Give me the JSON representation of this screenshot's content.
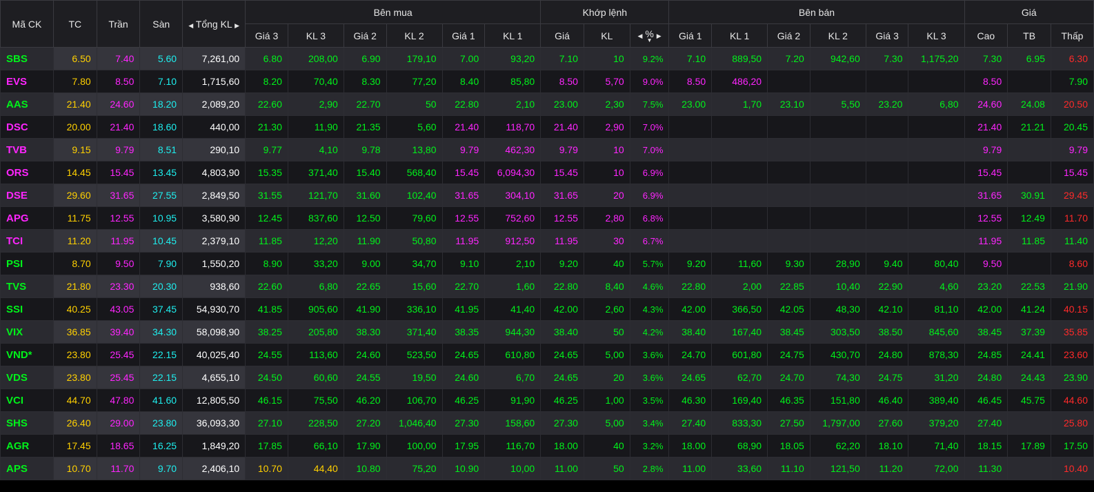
{
  "header": {
    "symbol": "Mã CK",
    "ref": "TC",
    "ceil": "Trần",
    "floor": "Sàn",
    "total_vol": "Tổng KL",
    "buy_group": "Bên mua",
    "match_group": "Khớp lệnh",
    "sell_group": "Bên bán",
    "price_group": "Giá",
    "bid3": "Giá 3",
    "bvol3": "KL 3",
    "bid2": "Giá 2",
    "bvol2": "KL 2",
    "bid1": "Giá 1",
    "bvol1": "KL 1",
    "mprice": "Giá",
    "mvol": "KL",
    "mpct": "%",
    "ask1": "Giá 1",
    "avol1": "KL 1",
    "ask2": "Giá 2",
    "avol2": "KL 2",
    "ask3": "Giá 3",
    "avol3": "KL 3",
    "high": "Cao",
    "avg": "TB",
    "low": "Thấp"
  },
  "colors": {
    "up": "#00f21a",
    "ceiling": "#ff25ff",
    "floor": "#1eeeee",
    "reference": "#ffd000",
    "down": "#ff2a2a"
  },
  "rows": [
    {
      "s": "SBS",
      "c": [
        "6.50",
        "7.40",
        "5.60",
        "7,261,00",
        "6.80",
        "208,00",
        "6.90",
        "179,10",
        "7.00",
        "93,20",
        "7.10",
        "10",
        "9.2%",
        "7.10",
        "889,50",
        "7.20",
        "942,60",
        "7.30",
        "1,175,20",
        "7.30",
        "6.95",
        "6.30"
      ],
      "k": [
        "u",
        "r",
        "c",
        "f",
        "w",
        "u",
        "u",
        "u",
        "u",
        "u",
        "u",
        "u",
        "u",
        "u",
        "u",
        "u",
        "u",
        "u",
        "u",
        "u",
        "u",
        "u",
        "d"
      ]
    },
    {
      "s": "EVS",
      "c": [
        "7.80",
        "8.50",
        "7.10",
        "1,715,60",
        "8.20",
        "70,40",
        "8.30",
        "77,20",
        "8.40",
        "85,80",
        "8.50",
        "5,70",
        "9.0%",
        "8.50",
        "486,20",
        "",
        "",
        "",
        "",
        "8.50",
        "",
        "7.90"
      ],
      "k": [
        "c",
        "r",
        "c",
        "f",
        "w",
        "u",
        "u",
        "u",
        "u",
        "u",
        "u",
        "c",
        "c",
        "c",
        "c",
        "c",
        "",
        "",
        "",
        "",
        "c",
        "",
        "u"
      ]
    },
    {
      "s": "AAS",
      "c": [
        "21.40",
        "24.60",
        "18.20",
        "2,089,20",
        "22.60",
        "2,90",
        "22.70",
        "50",
        "22.80",
        "2,10",
        "23.00",
        "2,30",
        "7.5%",
        "23.00",
        "1,70",
        "23.10",
        "5,50",
        "23.20",
        "6,80",
        "24.60",
        "24.08",
        "20.50"
      ],
      "k": [
        "u",
        "r",
        "c",
        "f",
        "w",
        "u",
        "u",
        "u",
        "u",
        "u",
        "u",
        "u",
        "u",
        "u",
        "u",
        "u",
        "u",
        "u",
        "u",
        "u",
        "c",
        "u",
        "d"
      ]
    },
    {
      "s": "DSC",
      "c": [
        "20.00",
        "21.40",
        "18.60",
        "440,00",
        "21.30",
        "11,90",
        "21.35",
        "5,60",
        "21.40",
        "118,70",
        "21.40",
        "2,90",
        "7.0%",
        "",
        "",
        "",
        "",
        "",
        "",
        "21.40",
        "21.21",
        "20.45"
      ],
      "k": [
        "c",
        "r",
        "c",
        "f",
        "w",
        "u",
        "u",
        "u",
        "u",
        "c",
        "c",
        "c",
        "c",
        "c",
        "",
        "",
        "",
        "",
        "",
        "",
        "c",
        "u",
        "u"
      ]
    },
    {
      "s": "TVB",
      "c": [
        "9.15",
        "9.79",
        "8.51",
        "290,10",
        "9.77",
        "4,10",
        "9.78",
        "13,80",
        "9.79",
        "462,30",
        "9.79",
        "10",
        "7.0%",
        "",
        "",
        "",
        "",
        "",
        "",
        "9.79",
        "",
        "9.79"
      ],
      "k": [
        "c",
        "r",
        "c",
        "f",
        "w",
        "u",
        "u",
        "u",
        "u",
        "c",
        "c",
        "c",
        "c",
        "c",
        "",
        "",
        "",
        "",
        "",
        "",
        "c",
        "",
        "c"
      ]
    },
    {
      "s": "ORS",
      "c": [
        "14.45",
        "15.45",
        "13.45",
        "4,803,90",
        "15.35",
        "371,40",
        "15.40",
        "568,40",
        "15.45",
        "6,094,30",
        "15.45",
        "10",
        "6.9%",
        "",
        "",
        "",
        "",
        "",
        "",
        "15.45",
        "",
        "15.45"
      ],
      "k": [
        "c",
        "r",
        "c",
        "f",
        "w",
        "u",
        "u",
        "u",
        "u",
        "c",
        "c",
        "c",
        "c",
        "c",
        "",
        "",
        "",
        "",
        "",
        "",
        "c",
        "",
        "c"
      ]
    },
    {
      "s": "DSE",
      "c": [
        "29.60",
        "31.65",
        "27.55",
        "2,849,50",
        "31.55",
        "121,70",
        "31.60",
        "102,40",
        "31.65",
        "304,10",
        "31.65",
        "20",
        "6.9%",
        "",
        "",
        "",
        "",
        "",
        "",
        "31.65",
        "30.91",
        "29.45"
      ],
      "k": [
        "c",
        "r",
        "c",
        "f",
        "w",
        "u",
        "u",
        "u",
        "u",
        "c",
        "c",
        "c",
        "c",
        "c",
        "",
        "",
        "",
        "",
        "",
        "",
        "c",
        "u",
        "d"
      ]
    },
    {
      "s": "APG",
      "c": [
        "11.75",
        "12.55",
        "10.95",
        "3,580,90",
        "12.45",
        "837,60",
        "12.50",
        "79,60",
        "12.55",
        "752,60",
        "12.55",
        "2,80",
        "6.8%",
        "",
        "",
        "",
        "",
        "",
        "",
        "12.55",
        "12.49",
        "11.70"
      ],
      "k": [
        "c",
        "r",
        "c",
        "f",
        "w",
        "u",
        "u",
        "u",
        "u",
        "c",
        "c",
        "c",
        "c",
        "c",
        "",
        "",
        "",
        "",
        "",
        "",
        "c",
        "u",
        "d"
      ]
    },
    {
      "s": "TCI",
      "c": [
        "11.20",
        "11.95",
        "10.45",
        "2,379,10",
        "11.85",
        "12,20",
        "11.90",
        "50,80",
        "11.95",
        "912,50",
        "11.95",
        "30",
        "6.7%",
        "",
        "",
        "",
        "",
        "",
        "",
        "11.95",
        "11.85",
        "11.40"
      ],
      "k": [
        "c",
        "r",
        "c",
        "f",
        "w",
        "u",
        "u",
        "u",
        "u",
        "c",
        "c",
        "c",
        "c",
        "c",
        "",
        "",
        "",
        "",
        "",
        "",
        "c",
        "u",
        "u"
      ]
    },
    {
      "s": "PSI",
      "c": [
        "8.70",
        "9.50",
        "7.90",
        "1,550,20",
        "8.90",
        "33,20",
        "9.00",
        "34,70",
        "9.10",
        "2,10",
        "9.20",
        "40",
        "5.7%",
        "9.20",
        "11,60",
        "9.30",
        "28,90",
        "9.40",
        "80,40",
        "9.50",
        "",
        "8.60"
      ],
      "k": [
        "u",
        "r",
        "c",
        "f",
        "w",
        "u",
        "u",
        "u",
        "u",
        "u",
        "u",
        "u",
        "u",
        "u",
        "u",
        "u",
        "u",
        "u",
        "u",
        "u",
        "c",
        "",
        "d"
      ]
    },
    {
      "s": "TVS",
      "c": [
        "21.80",
        "23.30",
        "20.30",
        "938,60",
        "22.60",
        "6,80",
        "22.65",
        "15,60",
        "22.70",
        "1,60",
        "22.80",
        "8,40",
        "4.6%",
        "22.80",
        "2,00",
        "22.85",
        "10,40",
        "22.90",
        "4,60",
        "23.20",
        "22.53",
        "21.90"
      ],
      "k": [
        "u",
        "r",
        "c",
        "f",
        "w",
        "u",
        "u",
        "u",
        "u",
        "u",
        "u",
        "u",
        "u",
        "u",
        "u",
        "u",
        "u",
        "u",
        "u",
        "u",
        "u",
        "u",
        "u"
      ]
    },
    {
      "s": "SSI",
      "c": [
        "40.25",
        "43.05",
        "37.45",
        "54,930,70",
        "41.85",
        "905,60",
        "41.90",
        "336,10",
        "41.95",
        "41,40",
        "42.00",
        "2,60",
        "4.3%",
        "42.00",
        "366,50",
        "42.05",
        "48,30",
        "42.10",
        "81,10",
        "42.00",
        "41.24",
        "40.15"
      ],
      "k": [
        "u",
        "r",
        "c",
        "f",
        "w",
        "u",
        "u",
        "u",
        "u",
        "u",
        "u",
        "u",
        "u",
        "u",
        "u",
        "u",
        "u",
        "u",
        "u",
        "u",
        "u",
        "u",
        "d"
      ]
    },
    {
      "s": "VIX",
      "c": [
        "36.85",
        "39.40",
        "34.30",
        "58,098,90",
        "38.25",
        "205,80",
        "38.30",
        "371,40",
        "38.35",
        "944,30",
        "38.40",
        "50",
        "4.2%",
        "38.40",
        "167,40",
        "38.45",
        "303,50",
        "38.50",
        "845,60",
        "38.45",
        "37.39",
        "35.85"
      ],
      "k": [
        "u",
        "r",
        "c",
        "f",
        "w",
        "u",
        "u",
        "u",
        "u",
        "u",
        "u",
        "u",
        "u",
        "u",
        "u",
        "u",
        "u",
        "u",
        "u",
        "u",
        "u",
        "u",
        "d"
      ]
    },
    {
      "s": "VND*",
      "c": [
        "23.80",
        "25.45",
        "22.15",
        "40,025,40",
        "24.55",
        "113,60",
        "24.60",
        "523,50",
        "24.65",
        "610,80",
        "24.65",
        "5,00",
        "3.6%",
        "24.70",
        "601,80",
        "24.75",
        "430,70",
        "24.80",
        "878,30",
        "24.85",
        "24.41",
        "23.60"
      ],
      "k": [
        "u",
        "r",
        "c",
        "f",
        "w",
        "u",
        "u",
        "u",
        "u",
        "u",
        "u",
        "u",
        "u",
        "u",
        "u",
        "u",
        "u",
        "u",
        "u",
        "u",
        "u",
        "u",
        "d"
      ]
    },
    {
      "s": "VDS",
      "c": [
        "23.80",
        "25.45",
        "22.15",
        "4,655,10",
        "24.50",
        "60,60",
        "24.55",
        "19,50",
        "24.60",
        "6,70",
        "24.65",
        "20",
        "3.6%",
        "24.65",
        "62,70",
        "24.70",
        "74,30",
        "24.75",
        "31,20",
        "24.80",
        "24.43",
        "23.90"
      ],
      "k": [
        "u",
        "r",
        "c",
        "f",
        "w",
        "u",
        "u",
        "u",
        "u",
        "u",
        "u",
        "u",
        "u",
        "u",
        "u",
        "u",
        "u",
        "u",
        "u",
        "u",
        "u",
        "u",
        "u"
      ]
    },
    {
      "s": "VCI",
      "c": [
        "44.70",
        "47.80",
        "41.60",
        "12,805,50",
        "46.15",
        "75,50",
        "46.20",
        "106,70",
        "46.25",
        "91,90",
        "46.25",
        "1,00",
        "3.5%",
        "46.30",
        "169,40",
        "46.35",
        "151,80",
        "46.40",
        "389,40",
        "46.45",
        "45.75",
        "44.60"
      ],
      "k": [
        "u",
        "r",
        "c",
        "f",
        "w",
        "u",
        "u",
        "u",
        "u",
        "u",
        "u",
        "u",
        "u",
        "u",
        "u",
        "u",
        "u",
        "u",
        "u",
        "u",
        "u",
        "u",
        "d"
      ]
    },
    {
      "s": "SHS",
      "c": [
        "26.40",
        "29.00",
        "23.80",
        "36,093,30",
        "27.10",
        "228,50",
        "27.20",
        "1,046,40",
        "27.30",
        "158,60",
        "27.30",
        "5,00",
        "3.4%",
        "27.40",
        "833,30",
        "27.50",
        "1,797,00",
        "27.60",
        "379,20",
        "27.40",
        "",
        "25.80"
      ],
      "k": [
        "u",
        "r",
        "c",
        "f",
        "w",
        "u",
        "u",
        "u",
        "u",
        "u",
        "u",
        "u",
        "u",
        "u",
        "u",
        "u",
        "u",
        "u",
        "u",
        "u",
        "u",
        "",
        "d"
      ]
    },
    {
      "s": "AGR",
      "c": [
        "17.45",
        "18.65",
        "16.25",
        "1,849,20",
        "17.85",
        "66,10",
        "17.90",
        "100,00",
        "17.95",
        "116,70",
        "18.00",
        "40",
        "3.2%",
        "18.00",
        "68,90",
        "18.05",
        "62,20",
        "18.10",
        "71,40",
        "18.15",
        "17.89",
        "17.50"
      ],
      "k": [
        "u",
        "r",
        "c",
        "f",
        "w",
        "u",
        "u",
        "u",
        "u",
        "u",
        "u",
        "u",
        "u",
        "u",
        "u",
        "u",
        "u",
        "u",
        "u",
        "u",
        "u",
        "u",
        "u"
      ]
    },
    {
      "s": "APS",
      "c": [
        "10.70",
        "11.70",
        "9.70",
        "2,406,10",
        "10.70",
        "44,40",
        "10.80",
        "75,20",
        "10.90",
        "10,00",
        "11.00",
        "50",
        "2.8%",
        "11.00",
        "33,60",
        "11.10",
        "121,50",
        "11.20",
        "72,00",
        "11.30",
        "",
        "10.40"
      ],
      "k": [
        "u",
        "r",
        "c",
        "f",
        "w",
        "r",
        "r",
        "u",
        "u",
        "u",
        "u",
        "u",
        "u",
        "u",
        "u",
        "u",
        "u",
        "u",
        "u",
        "u",
        "u",
        "",
        "d"
      ]
    }
  ]
}
